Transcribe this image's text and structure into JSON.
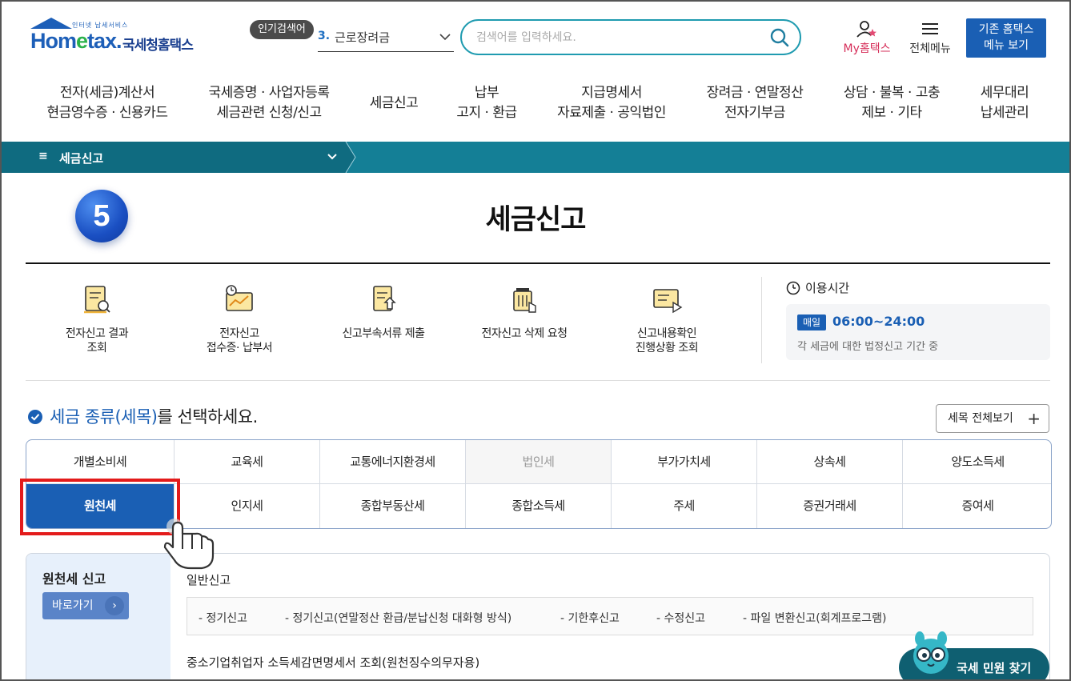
{
  "header": {
    "logo_small": "인터넷 납세서비스",
    "logo_main_pre": "Hom",
    "logo_main_e": "e",
    "logo_main_post": "tax.",
    "logo_kr": "국세청홈택스",
    "popular_badge": "인기검색어",
    "popular_rank": "3.",
    "popular_term": "근로장려금",
    "search_placeholder": "검색어를 입력하세요.",
    "my_hometax": "My홈택스",
    "all_menu": "전체메뉴",
    "old_menu_line1": "기존 홈택스",
    "old_menu_line2": "메뉴 보기"
  },
  "gnb": [
    {
      "l1": "전자(세금)계산서",
      "l2": "현금영수증 · 신용카드"
    },
    {
      "l1": "국세증명 · 사업자등록",
      "l2": "세금관련 신청/신고"
    },
    {
      "l1": "세금신고",
      "l2": ""
    },
    {
      "l1": "납부",
      "l2": "고지 · 환급"
    },
    {
      "l1": "지급명세서",
      "l2": "자료제출 · 공익법인"
    },
    {
      "l1": "장려금 · 연말정산",
      "l2": "전자기부금"
    },
    {
      "l1": "상담 · 불복 · 고충",
      "l2": "제보 · 기타"
    },
    {
      "l1": "세무대리",
      "l2": "납세관리"
    }
  ],
  "location": {
    "ham": "≡",
    "current": "세금신고"
  },
  "page": {
    "step_number": "5",
    "title": "세금신고"
  },
  "quick_menu": [
    {
      "icon": "report-result-icon",
      "l1": "전자신고 결과",
      "l2": "조회"
    },
    {
      "icon": "receipt-icon",
      "l1": "전자신고",
      "l2": "접수증· 납부서"
    },
    {
      "icon": "document-submit-icon",
      "l1": "신고부속서류 제출",
      "l2": ""
    },
    {
      "icon": "trash-delete-icon",
      "l1": "전자신고 삭제 요청",
      "l2": ""
    },
    {
      "icon": "progress-check-icon",
      "l1": "신고내용확인",
      "l2": "진행상황 조회"
    }
  ],
  "usage_time": {
    "title": "이용시간",
    "badge": "매일",
    "time": "06:00~24:00",
    "note": "각 세금에 대한 법정신고 기간 중"
  },
  "tax_select": {
    "title_pre": "세금 종류(세목)",
    "title_post": "를 선택하세요.",
    "all_view": "세목 전체보기",
    "all_view_plus": "+",
    "row1": [
      "개별소비세",
      "교육세",
      "교통에너지환경세",
      "법인세",
      "부가가치세",
      "상속세",
      "양도소득세"
    ],
    "row2": [
      "원천세",
      "인지세",
      "종합부동산세",
      "종합소득세",
      "주세",
      "증권거래세",
      "증여세"
    ],
    "selected": "원천세",
    "disabled": "법인세"
  },
  "detail": {
    "side_title": "원천세 신고",
    "go_button": "바로가기",
    "go_arrow": "›",
    "section1": "일반신고",
    "links": [
      "- 정기신고",
      "- 정기신고(연말정산 환급/분납신청 대화형 방식)",
      "- 기한후신고",
      "- 수정신고",
      "- 파일 변환신고(회계프로그램)"
    ],
    "section2": "중소기업취업자 소득세감면명세서 조회(원천징수의무자용)"
  },
  "chatbot": {
    "label": "국세 민원 찾기"
  },
  "colors": {
    "brand_blue": "#1a5fb4",
    "teal_bar": "#147f96",
    "highlight_red": "#e31b1b",
    "my_pink": "#d62f5a"
  }
}
